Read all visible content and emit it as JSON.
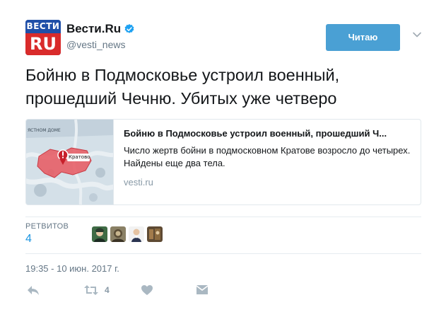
{
  "user": {
    "avatar_top": "ВЕСТИ",
    "avatar_bottom": "RU",
    "name": "Вести.Ru",
    "screen_name": "@vesti_news",
    "follow_label": "Читаю"
  },
  "tweet": {
    "text": "Бойню в Подмосковье устроил военный, прошедший Чечню. Убитых уже четверо"
  },
  "card": {
    "title": "Бойню в Подмосковье устроил военный, прошедший Ч...",
    "description": "Число жертв бойни в подмосковном Кратове возросло до четырех. Найдены еще два тела.",
    "domain": "vesti.ru",
    "map_label_top": "ЯСТНОМ ДОМЕ",
    "map_place": "Кратово"
  },
  "stats": {
    "retweets_label": "РЕТВИТОВ",
    "retweets_value": "4"
  },
  "timestamp": "19:35 - 10 июн. 2017 г.",
  "actions": {
    "retweet_count": "4"
  },
  "colors": {
    "accent": "#1b95e0",
    "follow_bg": "#4aa0d4",
    "muted": "#657786",
    "avatar_red": "#d92b2b",
    "avatar_blue": "#1f4fa8"
  }
}
